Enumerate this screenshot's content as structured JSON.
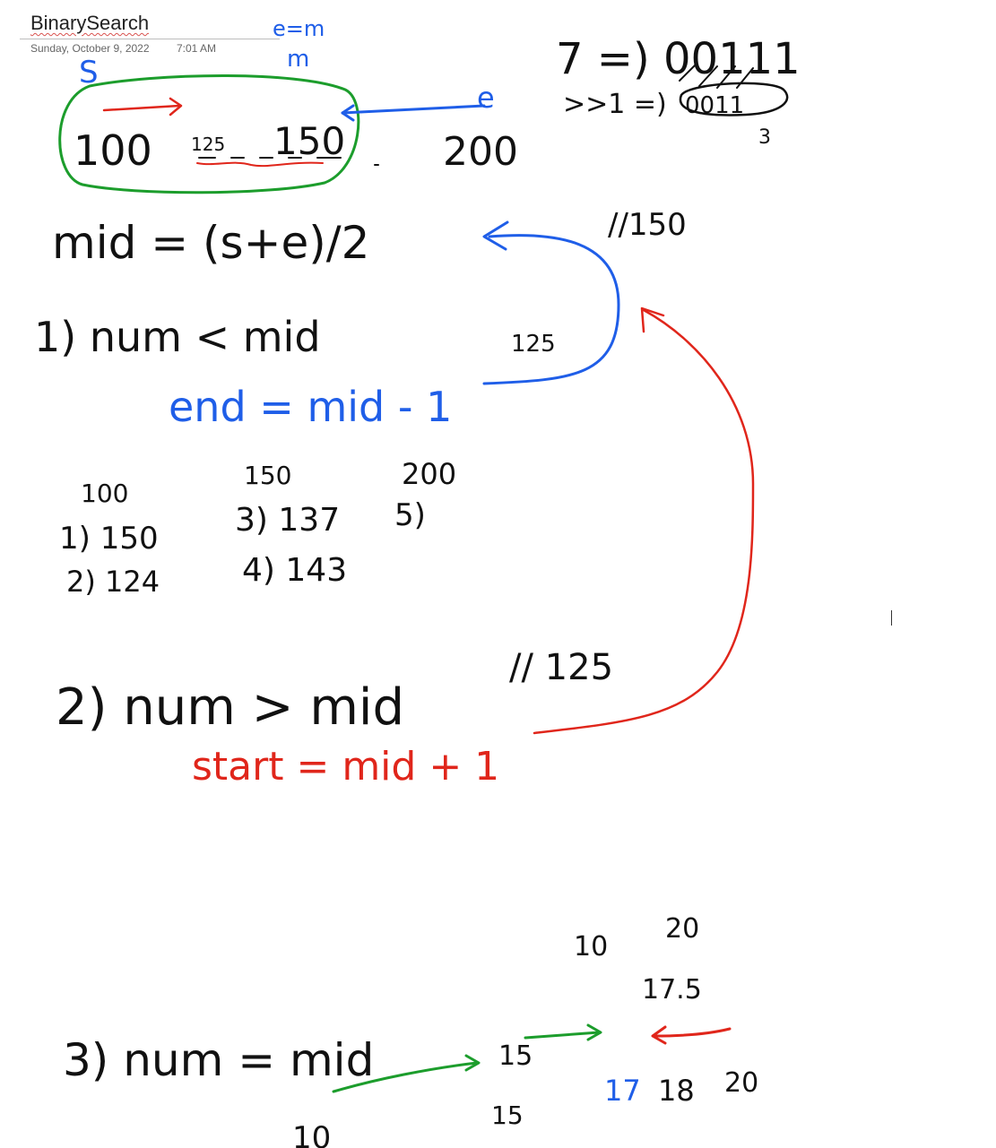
{
  "page": {
    "title": "BinarySearch",
    "date": "Sunday, October 9, 2022",
    "time": "7:01 AM"
  },
  "colors": {
    "ink_black": "#111111",
    "ink_blue": "#1f5ee8",
    "ink_red": "#e0261b",
    "ink_green": "#1c9d2c"
  },
  "ink": {
    "s_label": "S",
    "em_label": "e=m",
    "m_label": "m",
    "e_label": "e",
    "arr_100": "100",
    "arr_125": "125",
    "arr_150": "150",
    "arr_200": "200",
    "bits_line1": "7 =) 00111",
    "bits_line2": ">>1 =)",
    "bits_shifted": "0011",
    "bits_count": "3",
    "comment_150": "//150",
    "mid_formula": "mid = (s+e)/2",
    "case1": "1) num < mid",
    "note_125_a": "125",
    "end_rule": "end = mid - 1",
    "t_100": "100",
    "t_150": "150",
    "t_200": "200",
    "t_step1": "1) 150",
    "t_step2": "2) 124",
    "t_step3": "3) 137",
    "t_step4": "4) 143",
    "t_step5": "5)",
    "case2": "2) num > mid",
    "comment_125": "// 125",
    "start_rule": "start = mid + 1",
    "b_10": "10",
    "b_20": "20",
    "b_175": "17.5",
    "case3": "3) num = mid",
    "b_15_top": "15",
    "b_17": "17",
    "b_18": "18",
    "b_20b": "20",
    "b_15_bottom": "15",
    "b_10_bottom": "10"
  }
}
